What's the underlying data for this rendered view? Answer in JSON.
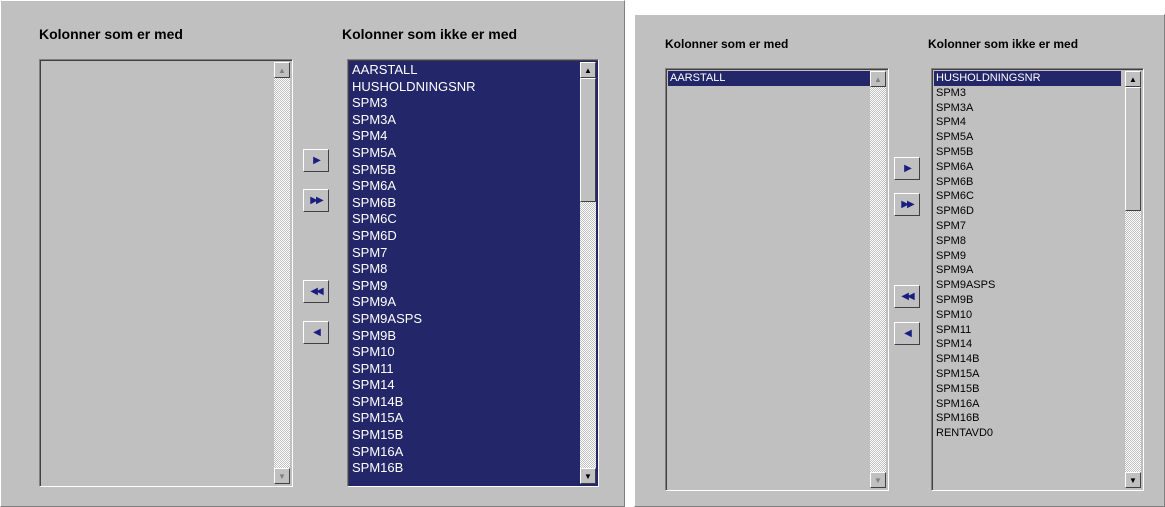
{
  "panel_left": {
    "included_header": "Kolonner som er med",
    "excluded_header": "Kolonner som ikke er med",
    "included_items": [],
    "excluded_items": [
      "AARSTALL",
      "HUSHOLDNINGSNR",
      "SPM3",
      "SPM3A",
      "SPM4",
      "SPM5A",
      "SPM5B",
      "SPM6A",
      "SPM6B",
      "SPM6C",
      "SPM6D",
      "SPM7",
      "SPM8",
      "SPM9",
      "SPM9A",
      "SPM9ASPS",
      "SPM9B",
      "SPM10",
      "SPM11",
      "SPM14",
      "SPM14B",
      "SPM15A",
      "SPM15B",
      "SPM16A",
      "SPM16B"
    ],
    "excluded_all_selected": true
  },
  "panel_right": {
    "included_header": "Kolonner som er med",
    "excluded_header": "Kolonner som ikke er med",
    "included_items": [
      "AARSTALL"
    ],
    "included_selected": "AARSTALL",
    "excluded_items": [
      "HUSHOLDNINGSNR",
      "SPM3",
      "SPM3A",
      "SPM4",
      "SPM5A",
      "SPM5B",
      "SPM6A",
      "SPM6B",
      "SPM6C",
      "SPM6D",
      "SPM7",
      "SPM8",
      "SPM9",
      "SPM9A",
      "SPM9ASPS",
      "SPM9B",
      "SPM10",
      "SPM11",
      "SPM14",
      "SPM14B",
      "SPM15A",
      "SPM15B",
      "SPM16A",
      "SPM16B",
      "RENTAVD0"
    ],
    "excluded_selected": "HUSHOLDNINGSNR"
  },
  "icons": {
    "move_one_right": "triangle-right-icon",
    "move_all_right": "double-triangle-right-icon",
    "move_all_left": "double-triangle-left-icon",
    "move_one_left": "triangle-left-icon",
    "scroll_up": "scroll-up-arrow-icon",
    "scroll_down": "scroll-down-arrow-icon"
  },
  "colors": {
    "selection": "#232669",
    "selection_text": "#ffffff",
    "face": "#c0c0c0",
    "arrow": "#1a1e80"
  }
}
